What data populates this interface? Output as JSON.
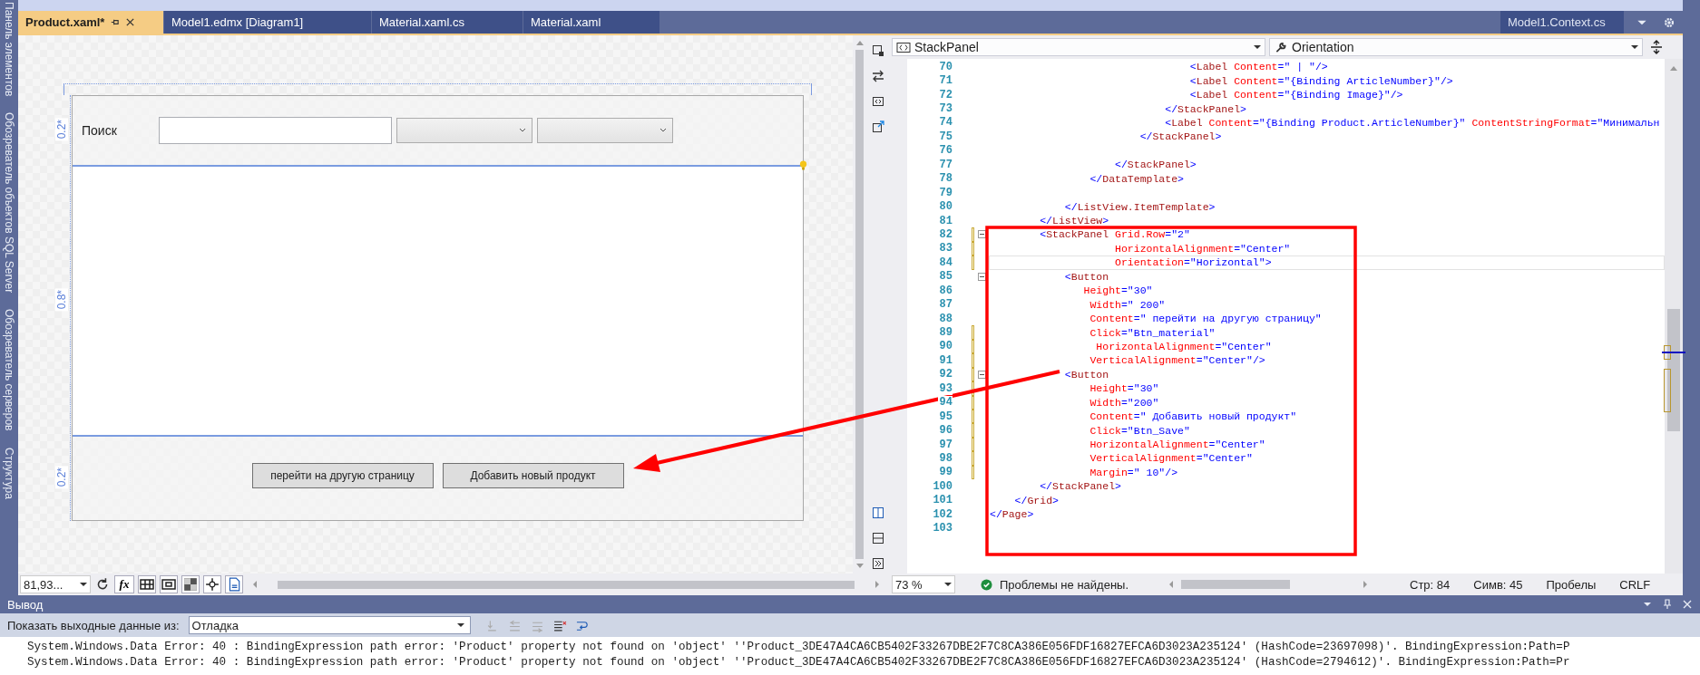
{
  "left_rail": {
    "items": [
      {
        "label": "Панель элементов"
      },
      {
        "label": "Обозреватель объектов SQL Server"
      },
      {
        "label": "Обозреватель серверов"
      },
      {
        "label": "Структура"
      }
    ]
  },
  "tabs": [
    {
      "label": "Product.xaml*",
      "selected": true
    },
    {
      "label": "Model1.edmx [Diagram1]",
      "selected": false
    },
    {
      "label": "Material.xaml.cs",
      "selected": false
    },
    {
      "label": "Material.xaml",
      "selected": false
    }
  ],
  "side_tab": {
    "label": "Model1.Context.cs"
  },
  "designer": {
    "search_label": "Поиск",
    "rows": [
      "0.2*",
      "0.8*",
      "0.2*"
    ],
    "buttons": [
      "перейти на другую страницу",
      "Добавить новый продукт"
    ],
    "zoom": "81,93...",
    "formula_button": "fx"
  },
  "editor": {
    "element": "StackPanel",
    "property": "Orientation",
    "lines": [
      {
        "n": "70",
        "text": "                                <Label Content=\" | \"/>",
        "changed": false,
        "fold": false,
        "current": false
      },
      {
        "n": "71",
        "text": "                                <Label Content=\"{Binding ArticleNumber}\"/>",
        "changed": false,
        "fold": false,
        "current": false
      },
      {
        "n": "72",
        "text": "                                <Label Content=\"{Binding Image}\"/>",
        "changed": false,
        "fold": false,
        "current": false
      },
      {
        "n": "73",
        "text": "                            </StackPanel>",
        "changed": false,
        "fold": false,
        "current": false
      },
      {
        "n": "74",
        "text": "                            <Label Content=\"{Binding Product.ArticleNumber}\" ContentStringFormat=\"Минимальн",
        "changed": false,
        "fold": false,
        "current": false
      },
      {
        "n": "75",
        "text": "                        </StackPanel>",
        "changed": false,
        "fold": false,
        "current": false
      },
      {
        "n": "76",
        "changed": false,
        "fold": false,
        "current": false
      },
      {
        "n": "77",
        "text": "                    </StackPanel>",
        "changed": false,
        "fold": false,
        "current": false
      },
      {
        "n": "78",
        "text": "                </DataTemplate>",
        "changed": false,
        "fold": false,
        "current": false
      },
      {
        "n": "79",
        "changed": false,
        "fold": false,
        "current": false
      },
      {
        "n": "80",
        "text": "            </ListView.ItemTemplate>",
        "changed": false,
        "fold": false,
        "current": false
      },
      {
        "n": "81",
        "text": "        </ListView>",
        "changed": false,
        "fold": false,
        "current": false
      },
      {
        "n": "82",
        "text": "        <StackPanel Grid.Row=\"2\"",
        "changed": true,
        "fold": true,
        "current": false
      },
      {
        "n": "83",
        "text": "                    HorizontalAlignment=\"Center\"",
        "changed": true,
        "fold": false,
        "current": false
      },
      {
        "n": "84",
        "text": "                    Orientation=\"Horizontal\">",
        "changed": true,
        "fold": false,
        "current": true
      },
      {
        "n": "85",
        "text": "            <Button",
        "changed": false,
        "fold": true,
        "current": false
      },
      {
        "n": "86",
        "text": "               Height=\"30\"",
        "changed": false,
        "fold": false,
        "current": false
      },
      {
        "n": "87",
        "text": "                Width=\" 200\"",
        "changed": false,
        "fold": false,
        "current": false
      },
      {
        "n": "88",
        "text": "                Content=\" перейти на другую страницу\"",
        "changed": false,
        "fold": false,
        "current": false
      },
      {
        "n": "89",
        "text": "                Click=\"Btn_material\"",
        "changed": true,
        "fold": false,
        "current": false
      },
      {
        "n": "90",
        "text": "                 HorizontalAlignment=\"Center\"",
        "changed": true,
        "fold": false,
        "current": false
      },
      {
        "n": "91",
        "text": "                VerticalAlignment=\"Center\"/>",
        "changed": true,
        "fold": false,
        "current": false
      },
      {
        "n": "92",
        "text": "            <Button",
        "changed": true,
        "fold": true,
        "current": false
      },
      {
        "n": "93",
        "text": "                Height=\"30\"",
        "changed": true,
        "fold": false,
        "current": false
      },
      {
        "n": "94",
        "text": "                Width=\"200\"",
        "changed": true,
        "fold": false,
        "current": false
      },
      {
        "n": "95",
        "text": "                Content=\" Добавить новый продукт\"",
        "changed": true,
        "fold": false,
        "current": false
      },
      {
        "n": "96",
        "text": "                Click=\"Btn_Save\"",
        "changed": true,
        "fold": false,
        "current": false
      },
      {
        "n": "97",
        "text": "                HorizontalAlignment=\"Center\"",
        "changed": true,
        "fold": false,
        "current": false
      },
      {
        "n": "98",
        "text": "                VerticalAlignment=\"Center\"",
        "changed": true,
        "fold": false,
        "current": false
      },
      {
        "n": "99",
        "text": "                Margin=\" 10\"/>",
        "changed": true,
        "fold": false,
        "current": false
      },
      {
        "n": "100",
        "text": "        </StackPanel>",
        "changed": false,
        "fold": false,
        "current": false
      },
      {
        "n": "101",
        "text": "    </Grid>",
        "changed": false,
        "fold": false,
        "current": false
      },
      {
        "n": "102",
        "text": "</Page>",
        "changed": false,
        "fold": false,
        "current": false
      },
      {
        "n": "103",
        "changed": false,
        "fold": false,
        "current": false
      }
    ],
    "zoom": "73 %",
    "problems": "Проблемы не найдены.",
    "line": "Стр: 84",
    "column": "Симв: 45",
    "indent": "Пробелы",
    "eol": "CRLF"
  },
  "output": {
    "title": "Вывод",
    "source_label": "Показать выходные данные из:",
    "source": "Отладка",
    "lines": [
      "System.Windows.Data Error: 40 : BindingExpression path error: 'Product' property not found on 'object' ''Product_3DE47A4CA6CB5402F33267DBE2F7C8CA386E056FDF16827EFCA6D3023A235124' (HashCode=23697098)'. BindingExpression:Path=P",
      "System.Windows.Data Error: 40 : BindingExpression path error: 'Product' property not found on 'object' ''Product_3DE47A4CA6CB5402F33267DBE2F7C8CA386E056FDF16827EFCA6D3023A235124' (HashCode=2794612)'. BindingExpression:Path=Pr"
    ]
  }
}
